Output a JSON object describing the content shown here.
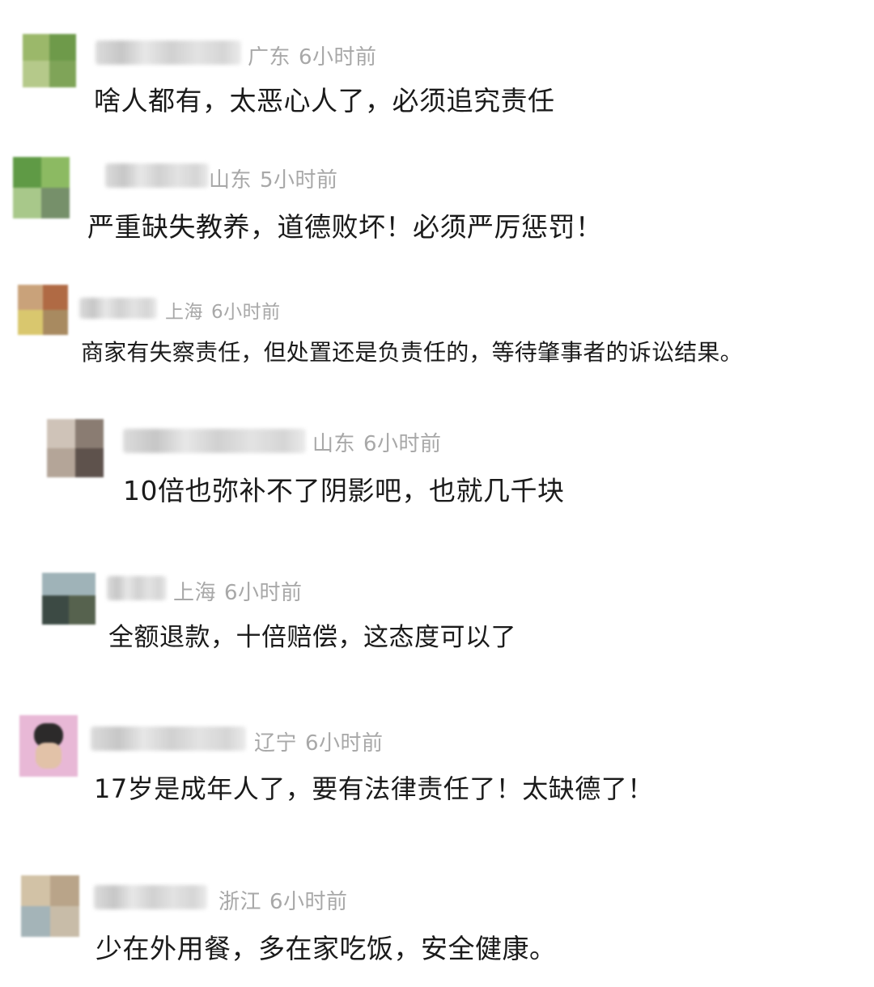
{
  "comments": [
    {
      "region": "广东",
      "time": "6小时前",
      "text": "啥人都有，太恶心人了，必须追究责任"
    },
    {
      "region": "山东",
      "time": "5小时前",
      "text": "严重缺失教养，道德败坏！必须严厉惩罚！"
    },
    {
      "region": "上海",
      "time": "6小时前",
      "text": "商家有失察责任，但处置还是负责任的，等待肇事者的诉讼结果。"
    },
    {
      "region": "山东",
      "time": "6小时前",
      "text": "10倍也弥补不了阴影吧，也就几千块"
    },
    {
      "region": "上海",
      "time": "6小时前",
      "text": "全额退款，十倍赔偿，这态度可以了"
    },
    {
      "region": "辽宁",
      "time": "6小时前",
      "text": "17岁是成年人了，要有法律责任了！太缺德了！"
    },
    {
      "region": "浙江",
      "time": "6小时前",
      "text": "少在外用餐，多在家吃饭，安全健康。"
    }
  ],
  "colors": {
    "meta": "#a8a8a8",
    "text": "#1a1a1a",
    "background": "#ffffff"
  }
}
